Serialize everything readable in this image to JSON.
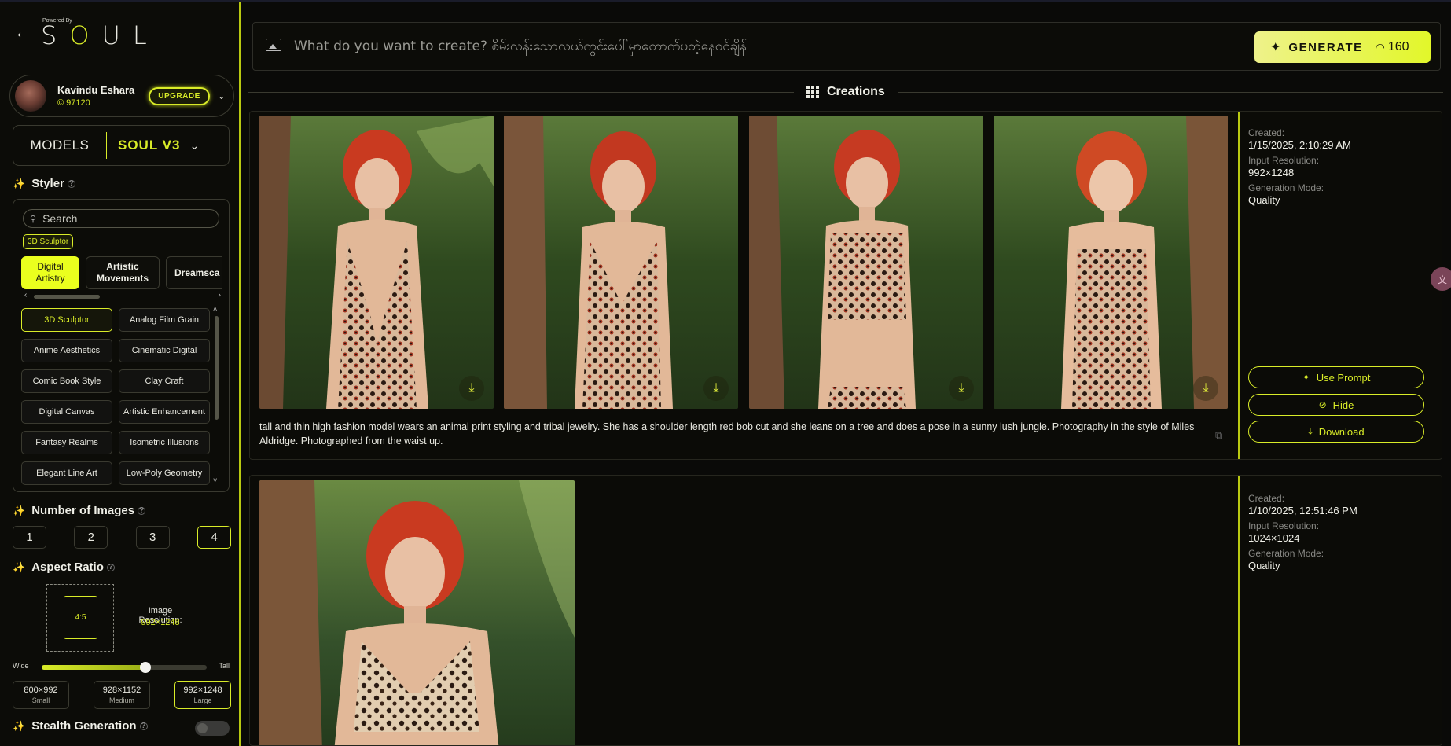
{
  "header": {
    "powered_by": "Powered By",
    "logo_text": "SOUL"
  },
  "user": {
    "name": "Kavindu Eshara",
    "credits": "© 97120",
    "upgrade_label": "UPGRADE"
  },
  "models": {
    "label": "MODELS",
    "selected": "SOUL V3"
  },
  "styler": {
    "title": "Styler",
    "search_placeholder": "Search",
    "selected_tag": "3D Sculptor",
    "categories": [
      "Digital Artistry",
      "Artistic Movements",
      "Dreamsca"
    ],
    "styles": [
      "3D Sculptor",
      "Analog Film Grain",
      "Anime Aesthetics",
      "Cinematic Digital",
      "Comic Book Style",
      "Clay Craft",
      "Digital Canvas",
      "Artistic Enhancement",
      "Fantasy Realms",
      "Isometric Illusions",
      "Elegant Line Art",
      "Low-Poly Geometry"
    ]
  },
  "number_of_images": {
    "title": "Number of Images",
    "options": [
      "1",
      "2",
      "3",
      "4"
    ],
    "selected": "4"
  },
  "aspect_ratio": {
    "title": "Aspect Ratio",
    "ratio": "4:5",
    "resolution_label": "Image Resolution:",
    "resolution_value": "992×1248",
    "wide_label": "Wide",
    "tall_label": "Tall",
    "slider_value": 0.63,
    "sizes": [
      {
        "res": "800×992",
        "name": "Small"
      },
      {
        "res": "928×1152",
        "name": "Medium"
      },
      {
        "res": "992×1248",
        "name": "Large"
      }
    ]
  },
  "stealth": {
    "title": "Stealth Generation",
    "enabled": false
  },
  "prompt_bar": {
    "placeholder": "What do you want to create? စိမ်းလန်းသောလယ်ကွင်းပေါ်မှာတောက်ပတဲ့နေဝင်ချိန်",
    "generate_label": "GENERATE",
    "generate_cost": "160"
  },
  "creations": {
    "title": "Creations",
    "items": [
      {
        "prompt": "tall and thin high fashion model wears an animal print styling and tribal jewelry. She has a shoulder length red bob cut and she leans on a tree and does a pose in a sunny lush jungle. Photography in the style of Miles Aldridge. Photographed from the waist up.",
        "created_label": "Created:",
        "created": "1/15/2025, 2:10:29 AM",
        "input_res_label": "Input Resolution:",
        "input_res": "992×1248",
        "mode_label": "Generation Mode:",
        "mode": "Quality",
        "actions": [
          "Use Prompt",
          "Hide",
          "Download"
        ]
      },
      {
        "created_label": "Created:",
        "created": "1/10/2025, 12:51:46 PM",
        "input_res_label": "Input Resolution:",
        "input_res": "1024×1024",
        "mode_label": "Generation Mode:",
        "mode": "Quality"
      }
    ]
  },
  "colors": {
    "accent": "#d9ec28",
    "background": "#0a0a08"
  }
}
